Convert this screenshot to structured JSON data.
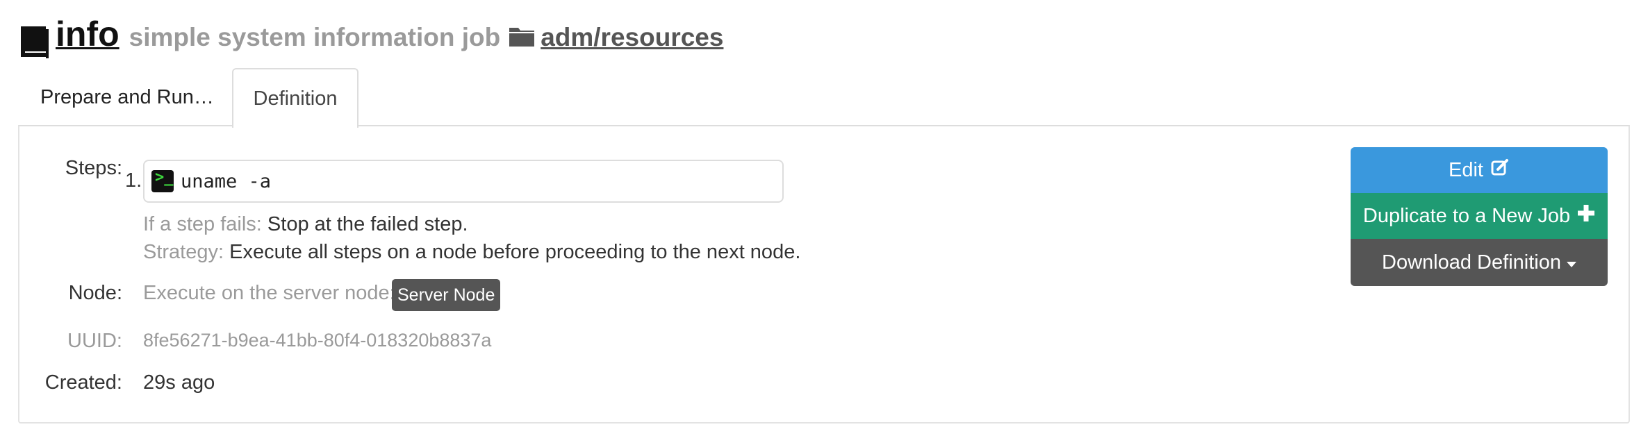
{
  "header": {
    "job_name": "info",
    "description": "simple system information job",
    "group_path": "adm/resources"
  },
  "tabs": [
    {
      "label": "Prepare and Run…",
      "active": false
    },
    {
      "label": "Definition",
      "active": true
    }
  ],
  "definition": {
    "steps_label": "Steps:",
    "steps": [
      {
        "number": "1.",
        "icon": "terminal-icon",
        "command": "uname -a"
      }
    ],
    "fail_label": "If a step fails:",
    "fail_value": "Stop at the failed step.",
    "strategy_label": "Strategy:",
    "strategy_value": "Execute all steps on a node before proceeding to the next node.",
    "node_label": "Node:",
    "node_text": "Execute on the server node:",
    "node_badge": "Server Node",
    "uuid_label": "UUID:",
    "uuid_value": "8fe56271-b9ea-41bb-80f4-018320b8837a",
    "created_label": "Created:",
    "created_value": "29s ago"
  },
  "actions": {
    "edit_label": "Edit",
    "duplicate_label": "Duplicate to a New Job",
    "download_label": "Download Definition"
  },
  "colors": {
    "edit": "#3a98dd",
    "duplicate": "#1f9b73",
    "download": "#555555",
    "badge": "#555555",
    "muted_text": "#9a9a9a"
  }
}
